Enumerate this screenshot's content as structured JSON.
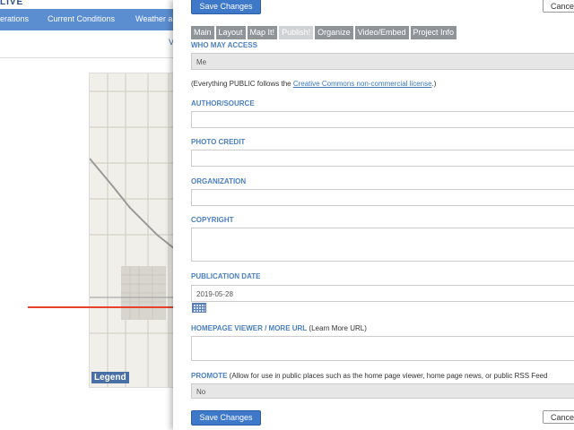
{
  "background": {
    "logo": "LIVE",
    "nav": [
      "erations",
      "Current Conditions",
      "Weather a"
    ],
    "subnav_letter": "V",
    "map_legend": "Legend"
  },
  "toolbar": {
    "save_label": "Save Changes",
    "cancel_label": "Cance"
  },
  "tabs": [
    {
      "label": "Main"
    },
    {
      "label": "Layout"
    },
    {
      "label": "Map It!"
    },
    {
      "label": "Publish!"
    },
    {
      "label": "Organize"
    },
    {
      "label": "Video/Embed"
    },
    {
      "label": "Project Info"
    }
  ],
  "form": {
    "who_may_access": {
      "label": "WHO MAY ACCESS",
      "value": "Me"
    },
    "license_note": {
      "prefix": "(Everything PUBLIC follows the ",
      "link": "Creative Commons non-commercial license",
      "suffix": ".)"
    },
    "author_source": {
      "label": "AUTHOR/SOURCE",
      "value": ""
    },
    "photo_credit": {
      "label": "PHOTO CREDIT",
      "value": ""
    },
    "organization": {
      "label": "ORGANIZATION",
      "value": ""
    },
    "copyright": {
      "label": "COPYRIGHT",
      "value": ""
    },
    "publication_date": {
      "label": "PUBLICATION DATE",
      "value": "2019-05-28"
    },
    "homepage_viewer": {
      "label": "HOMEPAGE VIEWER / MORE URL",
      "hint": " (Learn More URL)",
      "value": ""
    },
    "promote": {
      "label": "PROMOTE",
      "hint": " (Allow for use in public places such as the home page viewer, home page news, or public RSS Feed",
      "value": "No"
    }
  },
  "colors": {
    "accent": "#3d78c9",
    "label": "#4a7fc1",
    "arrow": "#e8412c",
    "nav": "#5b8ed1"
  }
}
